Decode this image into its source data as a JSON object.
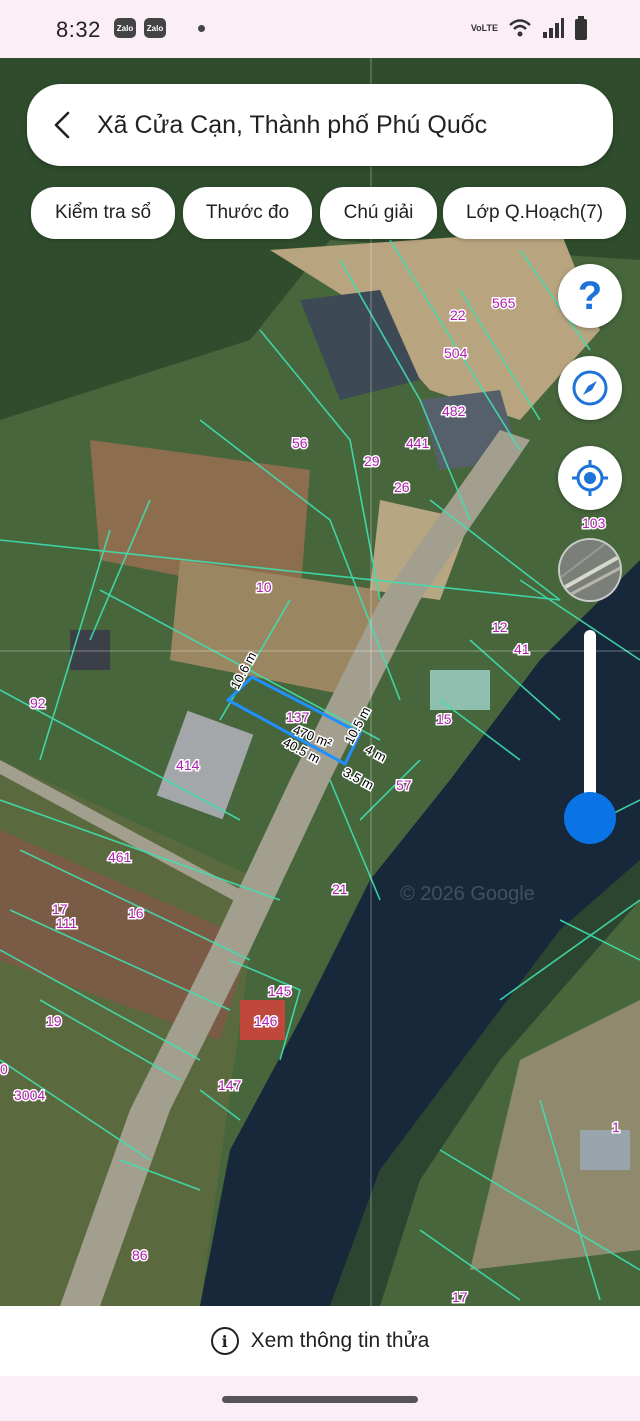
{
  "status_bar": {
    "time": "8:32",
    "notification_icons": [
      "Zalo",
      "Zalo"
    ],
    "network_label": "VoLTE"
  },
  "search": {
    "location_title": "Xã Cửa Cạn, Thành phố Phú Quốc"
  },
  "chips": [
    {
      "label": "Kiểm tra sổ"
    },
    {
      "label": "Thước đo"
    },
    {
      "label": "Chú giải"
    },
    {
      "label": "Lớp Q.Hoạch(7)"
    }
  ],
  "map": {
    "parcel_numbers": [
      "565",
      "22",
      "504",
      "482",
      "441",
      "56",
      "29",
      "26",
      "103",
      "10",
      "12",
      "41",
      "92",
      "137",
      "15",
      "414",
      "57",
      "461",
      "16",
      "17",
      "111",
      "21",
      "145",
      "146",
      "19",
      "3004",
      "147",
      "86",
      "1",
      "17",
      "0"
    ],
    "selected_parcel": {
      "area": "470 m²",
      "edges": [
        "10.6 m",
        "40.5 m",
        "10.5 m",
        "4 m",
        "3.5 m"
      ]
    },
    "watermark": "© 2026 Google",
    "colors": {
      "parcel_lines": "#3fe0b0",
      "selected_outline": "#1e90ff",
      "parcel_labels": "#b020b0",
      "accent": "#1e73d8"
    }
  },
  "controls": {
    "help_icon": "question-icon",
    "compass_icon": "compass-icon",
    "locate_icon": "locate-icon",
    "layer_icon": "map-layer-thumbnail",
    "zoom_level_fraction": 0.8
  },
  "bottom": {
    "info_icon": "info-icon",
    "label": "Xem thông tin thửa"
  }
}
